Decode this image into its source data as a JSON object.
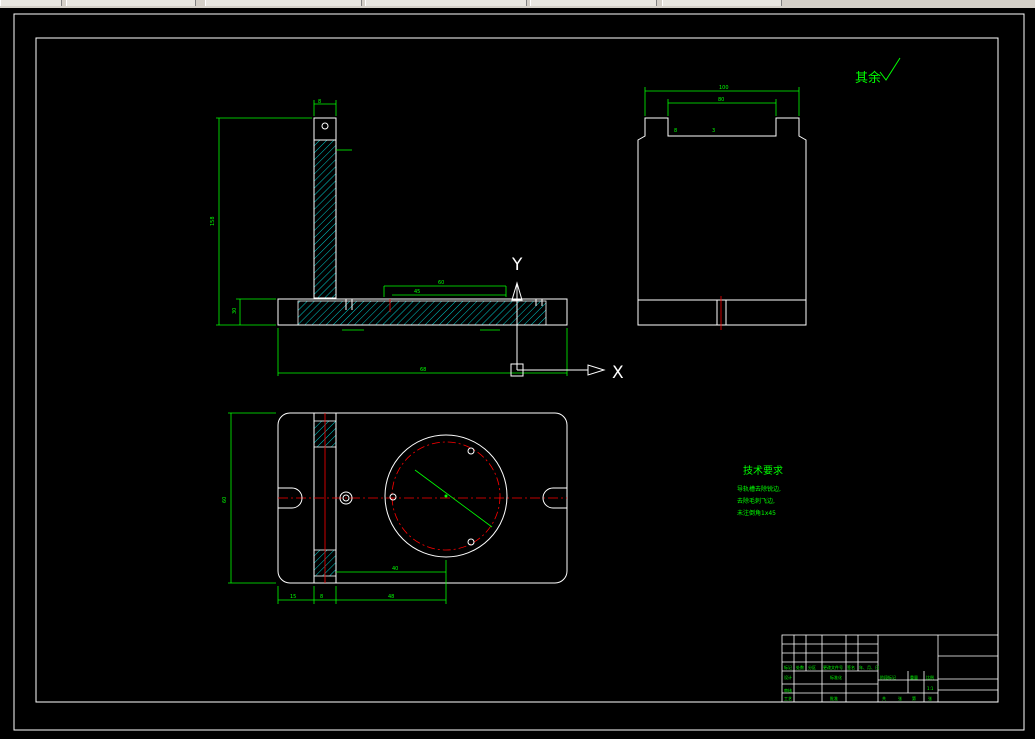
{
  "window": {
    "taskbar_tabs": [
      "",
      "",
      "",
      "",
      "",
      ""
    ]
  },
  "drawing": {
    "surface_note": "其余",
    "axis_x": "X",
    "axis_y": "Y",
    "tech_title": "技术要求",
    "tech_lines": [
      "导轨槽去除锐边,",
      "去除毛刺飞边,",
      "未注倒角1x45"
    ],
    "title_block": {
      "labels": [
        "标记",
        "处数",
        "分区",
        "更改文件号",
        "签名",
        "年、月、日",
        "设计",
        "标准化",
        "阶段标记",
        "重量",
        "比例",
        "审核",
        "工艺",
        "批准",
        "共",
        "张",
        "第",
        "张"
      ],
      "scale": "1:1"
    }
  },
  "colors": {
    "background": "#000000",
    "line": "#ffffff",
    "dimension": "#00ff00",
    "center_line": "#ff0000",
    "hatch": "#00ffff"
  }
}
